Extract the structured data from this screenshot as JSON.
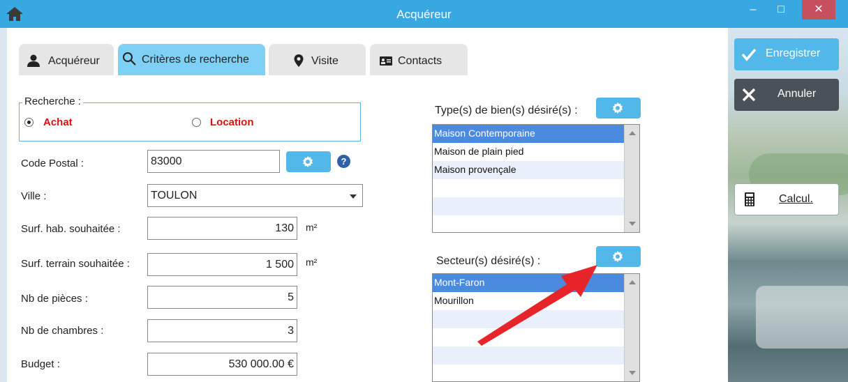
{
  "window": {
    "title": "Acquéreur",
    "min_glyph": "–",
    "max_glyph": "□",
    "close_glyph": "✕"
  },
  "tabs": [
    {
      "label": "Acquéreur",
      "icon": "user-icon",
      "active": false
    },
    {
      "label": "Critères de recherche",
      "icon": "search-icon",
      "active": true
    },
    {
      "label": "Visite",
      "icon": "map-pin-icon",
      "active": false
    },
    {
      "label": "Contacts",
      "icon": "contact-card-icon",
      "active": false
    }
  ],
  "search": {
    "legend": "Recherche :",
    "options": [
      {
        "label": "Achat",
        "selected": true
      },
      {
        "label": "Location",
        "selected": false
      }
    ]
  },
  "form": {
    "code_postal": {
      "label": "Code Postal :",
      "value": "83000"
    },
    "ville": {
      "label": "Ville :",
      "value": "TOULON"
    },
    "surf_hab": {
      "label": "Surf. hab. souhaitée :",
      "value": "130",
      "unit": "m²"
    },
    "surf_terrain": {
      "label": "Surf. terrain souhaitée :",
      "value": "1 500",
      "unit": "m²"
    },
    "nb_pieces": {
      "label": "Nb de pièces :",
      "value": "5"
    },
    "nb_chambres": {
      "label": "Nb de chambres :",
      "value": "3"
    },
    "budget": {
      "label": "Budget :",
      "value": "530 000.00 €"
    },
    "help_glyph": "?"
  },
  "types": {
    "label": "Type(s) de bien(s) désiré(s) :",
    "items": [
      "Maison Contemporaine",
      "Maison de plain pied",
      "Maison provençale"
    ],
    "selected_index": 0
  },
  "secteurs": {
    "label": "Secteur(s) désiré(s) :",
    "items": [
      "Mont-Faron",
      "Mourillon"
    ],
    "selected_index": 0
  },
  "actions": {
    "save": "Enregistrer",
    "cancel": "Annuler",
    "calc": "Calcul."
  },
  "colors": {
    "accent": "#38a8e3",
    "tab_active": "#7fd0f5",
    "radio_label": "#e01010",
    "list_selection": "#4a8be0",
    "annotation_arrow": "#e8242b"
  }
}
